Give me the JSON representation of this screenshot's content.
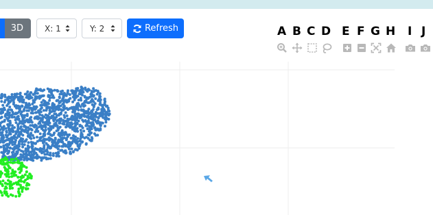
{
  "toolbar": {
    "mode_3d_label": "3D",
    "x_select_value": "X: 1",
    "y_select_value": "Y: 2",
    "refresh_label": "Refresh"
  },
  "modebar": {
    "letters": [
      "A",
      "B",
      "C",
      "D",
      "E",
      "F",
      "G",
      "H",
      "I",
      "J"
    ],
    "icons": [
      "zoom-icon",
      "pan-icon",
      "box-select-icon",
      "lasso-select-icon",
      "zoom-in-icon",
      "zoom-out-icon",
      "autoscale-icon",
      "reset-axes-icon",
      "camera-icon",
      "camera-icon"
    ]
  },
  "colors": {
    "primary": "#0d6efd",
    "secondary": "#6c757d",
    "cluster_blue": "#3a7fc6",
    "cluster_green": "#22ee22",
    "cursor_blue": "#5aa7e6",
    "topbar": "#d3ebef"
  }
}
